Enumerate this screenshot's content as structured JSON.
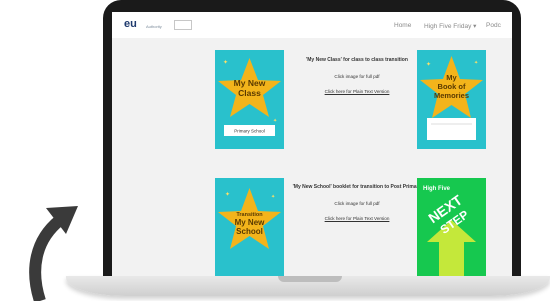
{
  "header": {
    "logo_text": "eu",
    "logo_sub": "Authority",
    "nav": [
      "Home",
      "High Five Friday ▾",
      "Podc"
    ]
  },
  "items": [
    {
      "title": "'My New Class' for class to class transition",
      "click_text": "Click image for full pdf",
      "link_text": "Click here for Plain Text Version"
    },
    {
      "title": "'My New School' booklet for transition to Post Primary",
      "click_text": "Click image for full pdf",
      "link_text": "Click here for Plain Text Version"
    }
  ],
  "covers": {
    "my_new_class": {
      "title_lines": [
        "My New",
        "Class"
      ],
      "label": "Primary School"
    },
    "book_of_memories": {
      "title_lines": [
        "My",
        "Book of",
        "Memories"
      ]
    },
    "my_new_school": {
      "title_lines": [
        "Transition",
        "My New",
        "School"
      ]
    },
    "next_step": {
      "brand": "High Five",
      "words": [
        "NEXT",
        "STEP"
      ]
    }
  },
  "colors": {
    "teal": "#29c1cc",
    "star": "#f3b41b",
    "green": "#16c84f",
    "lime": "#c4e83a"
  }
}
